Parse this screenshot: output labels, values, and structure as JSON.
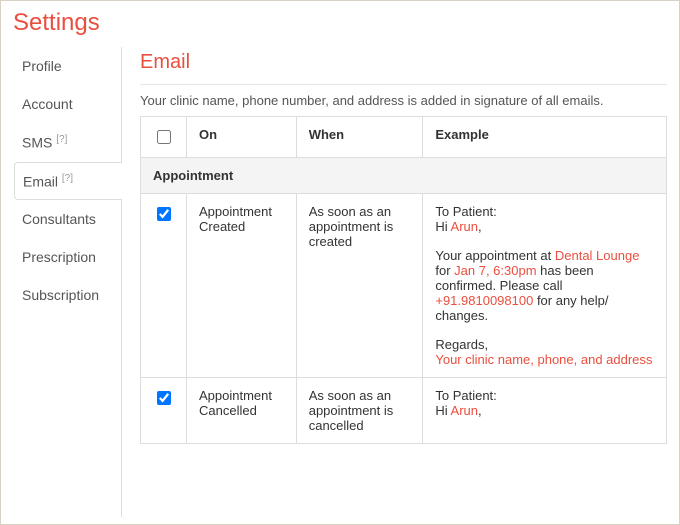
{
  "page_title": "Settings",
  "sidebar": {
    "items": [
      {
        "label": "Profile",
        "sup": ""
      },
      {
        "label": "Account",
        "sup": ""
      },
      {
        "label": "SMS",
        "sup": "[?]"
      },
      {
        "label": "Email",
        "sup": "[?]"
      },
      {
        "label": "Consultants",
        "sup": ""
      },
      {
        "label": "Prescription",
        "sup": ""
      },
      {
        "label": "Subscription",
        "sup": ""
      }
    ]
  },
  "section_title": "Email",
  "intro_text": "Your clinic name, phone number, and address is added in signature of all emails.",
  "table": {
    "headers": {
      "on": "On",
      "when": "When",
      "example": "Example"
    },
    "group_label": "Appointment",
    "rows": [
      {
        "checked": true,
        "on": "Appointment Created",
        "when": "As soon as an appointment is created",
        "example": {
          "to": "To Patient:",
          "greeting_prefix": "Hi ",
          "greeting_name": "Arun",
          "greeting_suffix": ",",
          "body_1": "Your appointment at ",
          "clinic": "Dental Lounge",
          "body_2": " for ",
          "datetime": "Jan 7, 6:30pm",
          "body_3": " has been confirmed. Please call ",
          "phone": "+91.9810098100",
          "body_4": " for any help/ changes.",
          "regards": "Regards,",
          "signature": "Your clinic name, phone, and address"
        }
      },
      {
        "checked": true,
        "on": "Appointment Cancelled",
        "when": "As soon as an appointment is cancelled",
        "example": {
          "to": "To Patient:",
          "greeting_prefix": "Hi ",
          "greeting_name": "Arun",
          "greeting_suffix": ","
        }
      }
    ]
  }
}
